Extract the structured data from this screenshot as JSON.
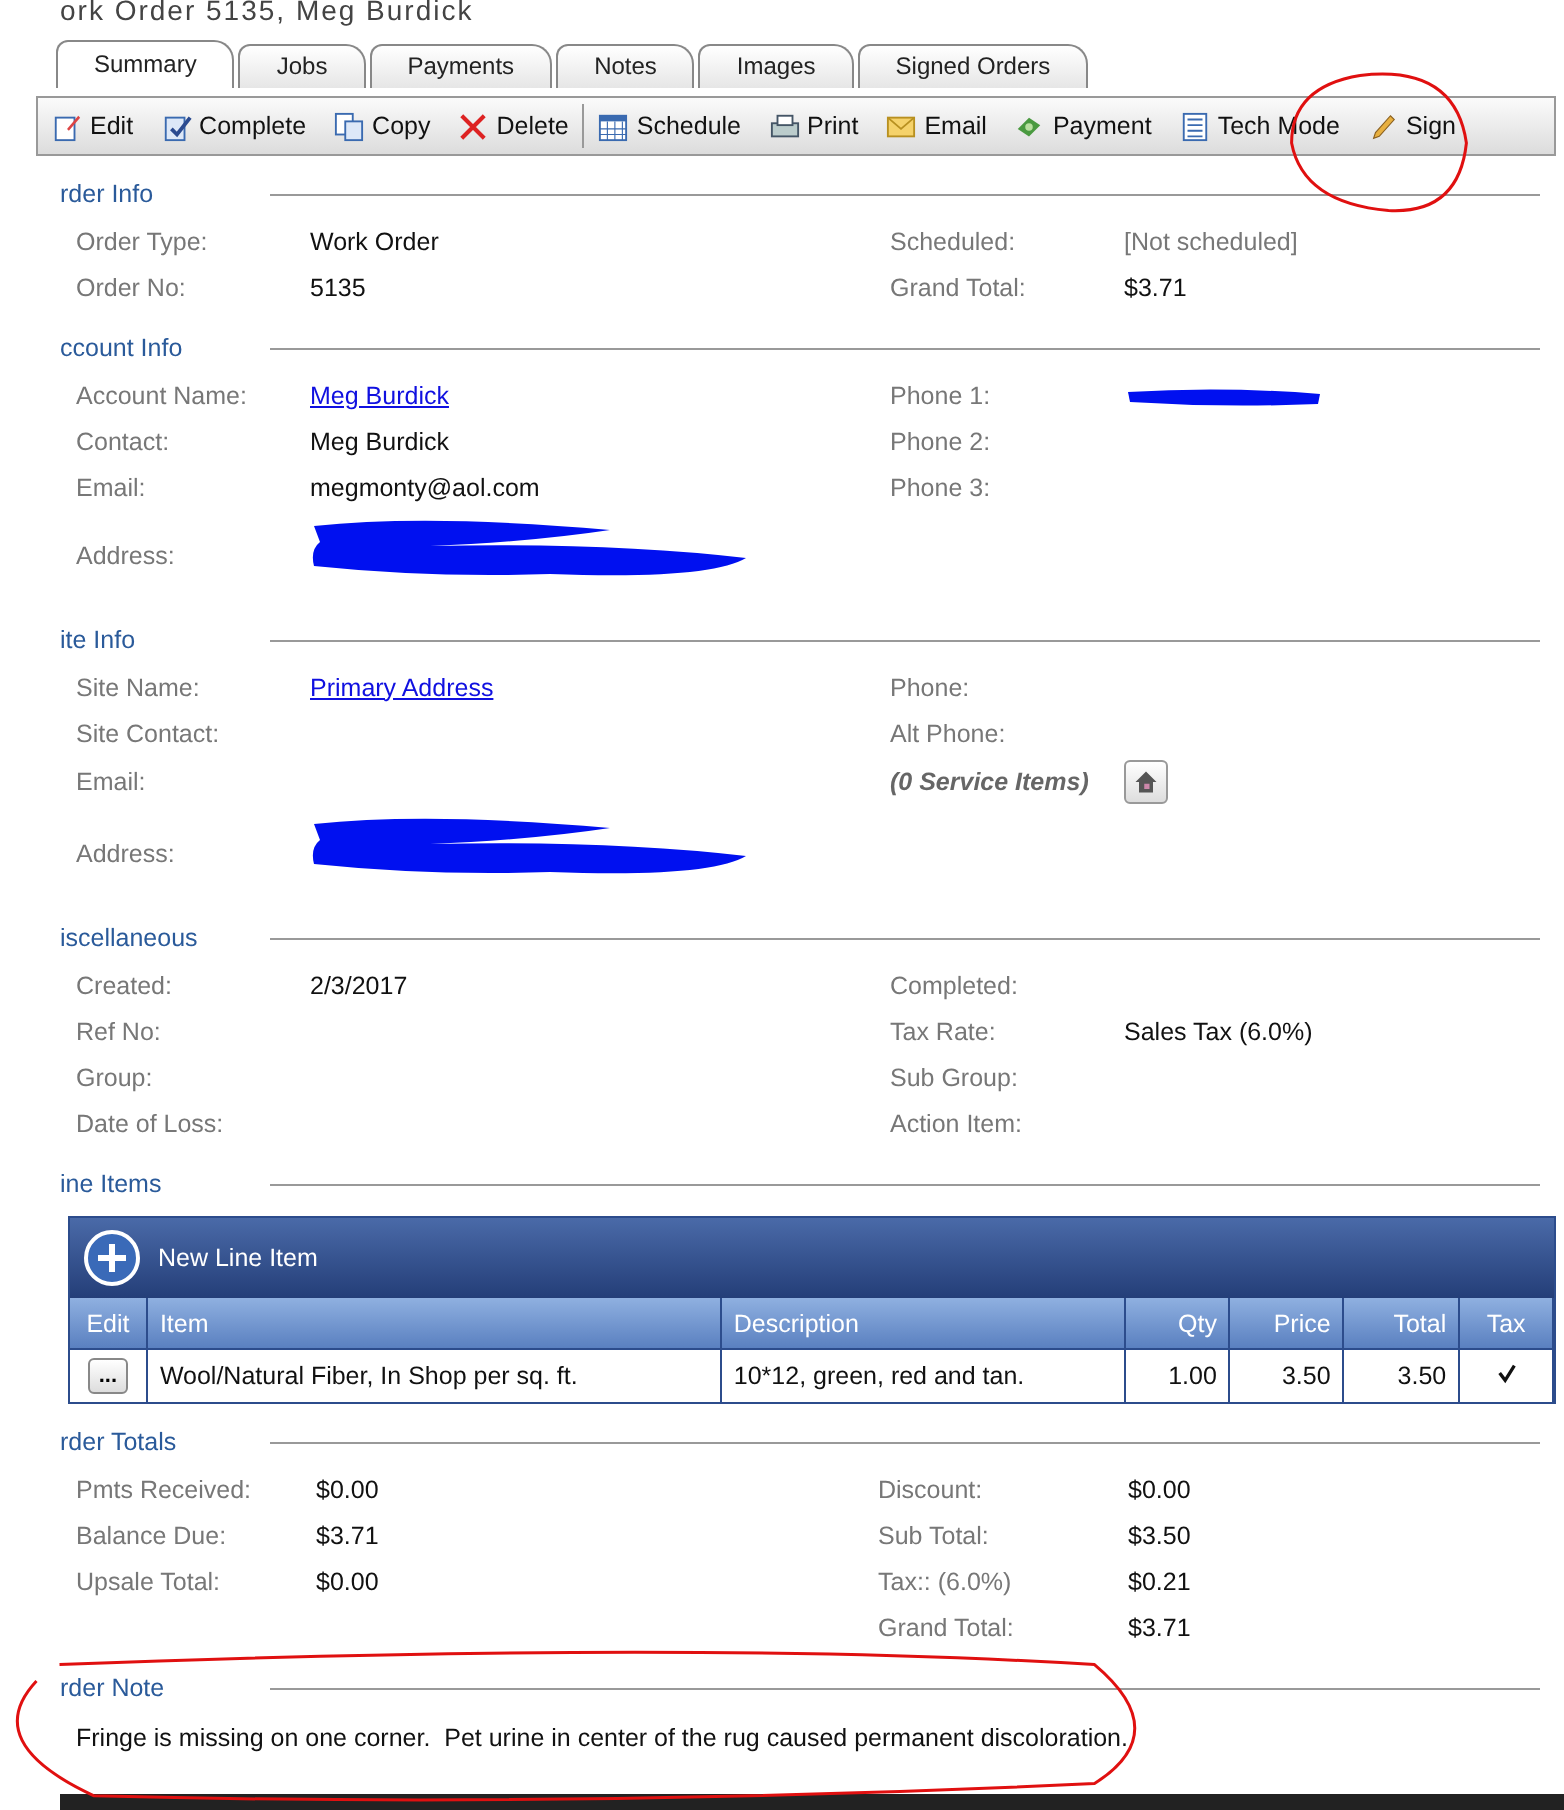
{
  "title": "ork Order 5135, Meg Burdick",
  "tabs": [
    {
      "label": "Summary",
      "selected": true
    },
    {
      "label": "Jobs",
      "selected": false
    },
    {
      "label": "Payments",
      "selected": false
    },
    {
      "label": "Notes",
      "selected": false
    },
    {
      "label": "Images",
      "selected": false
    },
    {
      "label": "Signed Orders",
      "selected": false
    }
  ],
  "toolbar": [
    {
      "label": "Edit",
      "kind": "edit",
      "separator_before": false
    },
    {
      "label": "Complete",
      "kind": "complete",
      "separator_before": false
    },
    {
      "label": "Copy",
      "kind": "copy",
      "separator_before": false
    },
    {
      "label": "Delete",
      "kind": "delete",
      "separator_before": false
    },
    {
      "label": "Schedule",
      "kind": "schedule",
      "separator_before": true
    },
    {
      "label": "Print",
      "kind": "print",
      "separator_before": false
    },
    {
      "label": "Email",
      "kind": "email",
      "separator_before": false
    },
    {
      "label": "Payment",
      "kind": "payment",
      "separator_before": false
    },
    {
      "label": "Tech Mode",
      "kind": "tech",
      "separator_before": false
    },
    {
      "label": "Sign",
      "kind": "sign",
      "separator_before": false
    }
  ],
  "sections": [
    {
      "heading": "rder Info",
      "rows": [
        [
          {
            "label": "Order Type:",
            "value": "Work Order",
            "kind": "text"
          },
          {
            "label": "Scheduled:",
            "value": "[Not scheduled]",
            "kind": "muted"
          }
        ],
        [
          {
            "label": "Order No:",
            "value": "5135",
            "kind": "text"
          },
          {
            "label": "Grand Total:",
            "value": "$3.71",
            "kind": "text"
          }
        ]
      ]
    },
    {
      "heading": "ccount Info",
      "rows": [
        [
          {
            "label": "Account Name:",
            "value": "Meg Burdick",
            "kind": "link"
          },
          {
            "label": "Phone 1:",
            "kind": "redacted"
          }
        ],
        [
          {
            "label": "Contact:",
            "value": "Meg Burdick",
            "kind": "text"
          },
          {
            "label": "Phone 2:",
            "kind": "text"
          }
        ],
        [
          {
            "label": "Email:",
            "value": "megmonty@aol.com",
            "kind": "text"
          },
          {
            "label": "Phone 3:",
            "kind": "text"
          }
        ],
        [
          {
            "label": "Address:",
            "kind": "redacted_block"
          },
          {
            "kind": "text"
          }
        ]
      ]
    },
    {
      "heading": "ite Info",
      "rows": [
        [
          {
            "label": "Site Name:",
            "value": "Primary Address",
            "kind": "link"
          },
          {
            "label": "Phone:",
            "kind": "text"
          }
        ],
        [
          {
            "label": "Site Contact:",
            "kind": "text"
          },
          {
            "label": "Alt Phone:",
            "kind": "text"
          }
        ],
        [
          {
            "label": "Email:",
            "kind": "text"
          },
          {
            "label": "(0 Service Items)",
            "kind": "service"
          }
        ],
        [
          {
            "label": "Address:",
            "kind": "redacted_block"
          },
          {
            "kind": "text"
          }
        ]
      ]
    },
    {
      "heading": "iscellaneous",
      "rows": [
        [
          {
            "label": "Created:",
            "value": "2/3/2017",
            "kind": "text"
          },
          {
            "label": "Completed:",
            "kind": "text"
          }
        ],
        [
          {
            "label": "Ref No:",
            "kind": "text"
          },
          {
            "label": "Tax Rate:",
            "value": "Sales Tax (6.0%)",
            "kind": "text"
          }
        ],
        [
          {
            "label": "Group:",
            "kind": "text"
          },
          {
            "label": "Sub Group:",
            "kind": "text"
          }
        ],
        [
          {
            "label": "Date of Loss:",
            "kind": "text"
          },
          {
            "label": "Action Item:",
            "kind": "text"
          }
        ]
      ]
    }
  ],
  "line_items": {
    "heading": "ine Items",
    "new_label": "New Line Item",
    "columns": [
      "Edit",
      "Item",
      "Description",
      "Qty",
      "Price",
      "Total",
      "Tax"
    ],
    "rows": [
      {
        "edit": "...",
        "item": "Wool/Natural Fiber, In Shop per sq. ft.",
        "description": "10*12, green, red and tan.",
        "qty": "1.00",
        "price": "3.50",
        "total": "3.50",
        "taxed": true
      }
    ]
  },
  "totals": {
    "heading": "rder Totals",
    "rows": [
      [
        {
          "label": "Pmts Received:",
          "value": "$0.00"
        },
        {
          "label": "Discount:",
          "value": "$0.00"
        }
      ],
      [
        {
          "label": "Balance Due:",
          "value": "$3.71"
        },
        {
          "label": "Sub Total:",
          "value": "$3.50"
        }
      ],
      [
        {
          "label": "Upsale Total:",
          "value": "$0.00"
        },
        {
          "label": "Tax:: (6.0%)",
          "value": "$0.21"
        }
      ],
      [
        {},
        {
          "label": "Grand Total:",
          "value": "$3.71"
        }
      ]
    ]
  },
  "note": {
    "heading": "rder Note",
    "text": "Fringe is missing on one corner.  Pet urine in center of the rug caused permanent discoloration."
  }
}
